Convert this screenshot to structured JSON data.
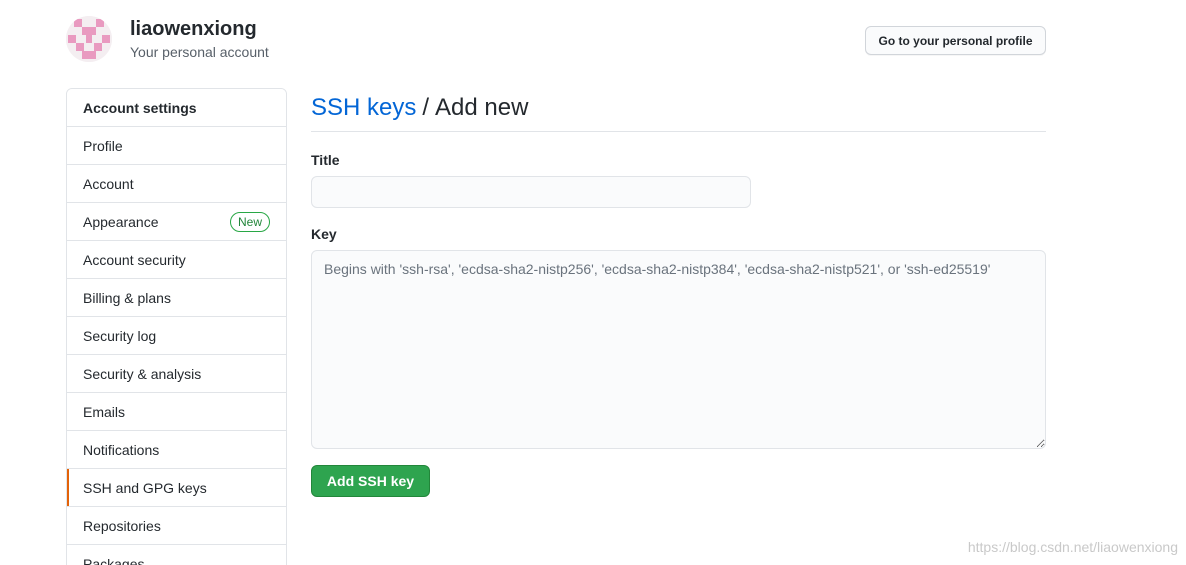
{
  "header": {
    "username": "liaowenxiong",
    "account_type": "Your personal account",
    "profile_button": "Go to your personal profile"
  },
  "sidebar": {
    "heading": "Account settings",
    "items": [
      {
        "label": "Profile"
      },
      {
        "label": "Account"
      },
      {
        "label": "Appearance",
        "badge": "New"
      },
      {
        "label": "Account security"
      },
      {
        "label": "Billing & plans"
      },
      {
        "label": "Security log"
      },
      {
        "label": "Security & analysis"
      },
      {
        "label": "Emails"
      },
      {
        "label": "Notifications"
      },
      {
        "label": "SSH and GPG keys",
        "selected": true
      },
      {
        "label": "Repositories"
      },
      {
        "label": "Packages"
      }
    ],
    "selected_accent": "#e36209"
  },
  "main": {
    "breadcrumb_link": "SSH keys",
    "breadcrumb_separator": "/",
    "breadcrumb_current": "Add new",
    "title_label": "Title",
    "title_value": "",
    "key_label": "Key",
    "key_placeholder": "Begins with 'ssh-rsa', 'ecdsa-sha2-nistp256', 'ecdsa-sha2-nistp384', 'ecdsa-sha2-nistp521', or 'ssh-ed25519'",
    "submit_label": "Add SSH key"
  },
  "watermark": "https://blog.csdn.net/liaowenxiong",
  "colors": {
    "link": "#0366d6",
    "primary_button": "#2ea44f",
    "badge_green": "#22863a",
    "avatar_pink": "#e99ac0"
  }
}
